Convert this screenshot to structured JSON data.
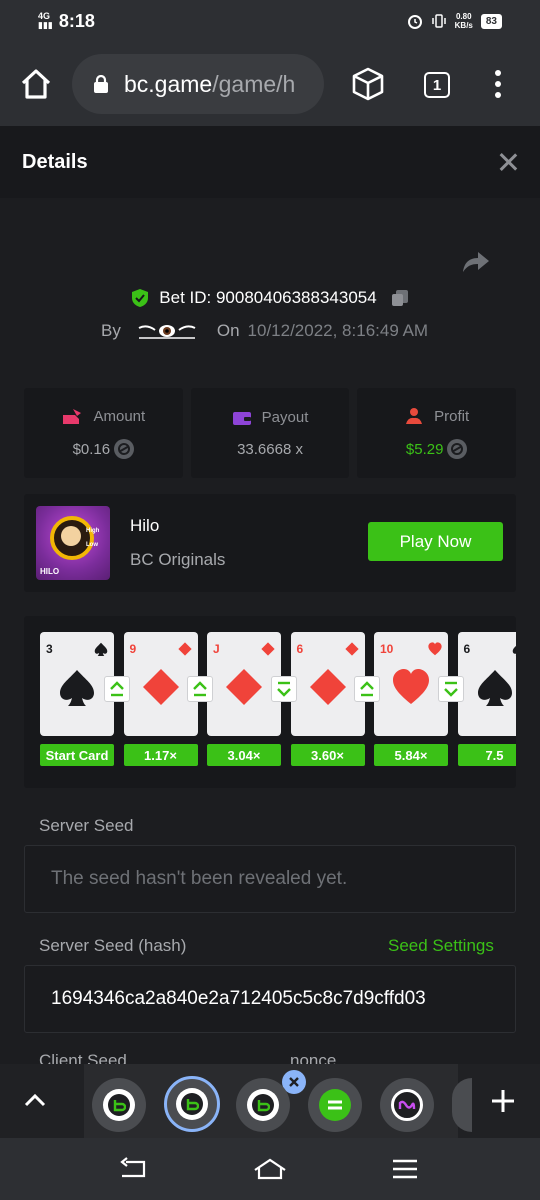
{
  "status": {
    "network": "4G",
    "time": "8:18",
    "speed_value": "0.80",
    "speed_unit": "KB/s",
    "battery": "83"
  },
  "browser": {
    "url_host": "bc.game",
    "url_path": "/game/h",
    "tab_count": "1"
  },
  "header": {
    "title": "Details"
  },
  "bet": {
    "id_label": "Bet ID: 90080406388343054",
    "by_label": "By",
    "on_label": "On",
    "date": "10/12/2022, 8:16:49 AM"
  },
  "stats": {
    "amount": {
      "label": "Amount",
      "value": "$0.16"
    },
    "payout": {
      "label": "Payout",
      "value": "33.6668 x"
    },
    "profit": {
      "label": "Profit",
      "value": "$5.29"
    }
  },
  "game": {
    "name": "Hilo",
    "provider": "BC Originals",
    "play_label": "Play Now",
    "thumb_text": "HILO",
    "thumb_high": "High",
    "thumb_low": "Low"
  },
  "cards": [
    {
      "rank": "3",
      "suit": "spade",
      "mult": "Start Card"
    },
    {
      "rank": "9",
      "suit": "diamond",
      "mult": "1.17×",
      "arrow": "up"
    },
    {
      "rank": "J",
      "suit": "diamond",
      "mult": "3.04×",
      "arrow": "up"
    },
    {
      "rank": "6",
      "suit": "diamond",
      "mult": "3.60×",
      "arrow": "down"
    },
    {
      "rank": "10",
      "suit": "heart",
      "mult": "5.84×",
      "arrow": "up"
    },
    {
      "rank": "6",
      "suit": "spade",
      "mult": "7.5",
      "arrow": "down"
    }
  ],
  "seeds": {
    "server_seed_label": "Server Seed",
    "server_seed_placeholder": "The seed hasn't been revealed yet.",
    "server_hash_label": "Server Seed (hash)",
    "seed_settings_label": "Seed Settings",
    "server_hash_value": "1694346ca2a840e2a712405c5c8c7d9cffd03",
    "client_seed_label": "Client Seed",
    "nonce_label": "nonce"
  },
  "colors": {
    "accent_green": "#3bc117",
    "panel": "#17181b",
    "background": "#1c1d20",
    "card_red": "#f0433a"
  }
}
